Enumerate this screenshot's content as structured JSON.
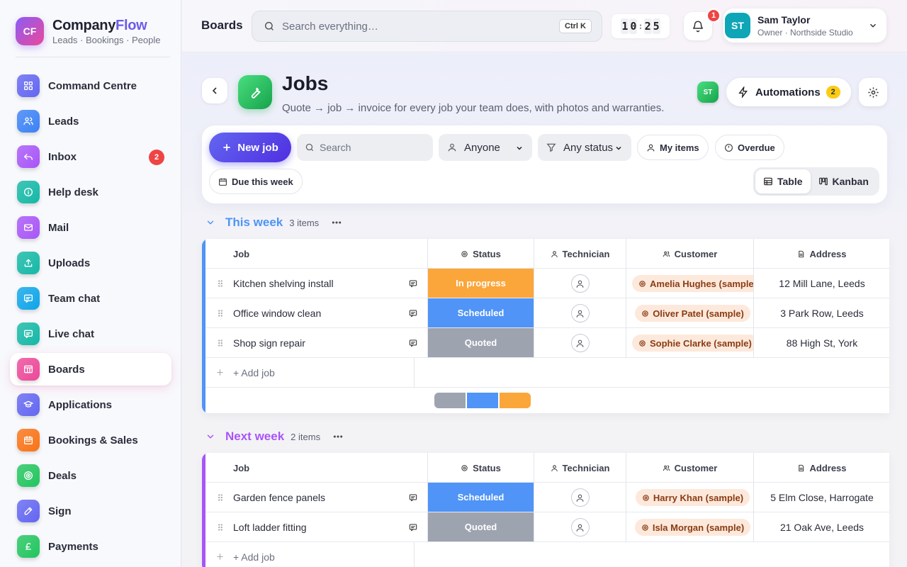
{
  "brand": {
    "initials": "CF",
    "name_a": "Company",
    "name_b": "Flow",
    "subtitle": "Leads · Bookings · People"
  },
  "nav": [
    {
      "label": "Command Centre",
      "icon": "grid-icon",
      "color": "#6366f1"
    },
    {
      "label": "Leads",
      "icon": "users-icon",
      "color": "#3b82f6"
    },
    {
      "label": "Inbox",
      "icon": "reply-icon",
      "color": "#a855f7",
      "badge": "2"
    },
    {
      "label": "Help desk",
      "icon": "info-icon",
      "color": "#14b8a6"
    },
    {
      "label": "Mail",
      "icon": "mail-icon",
      "color": "#a855f7"
    },
    {
      "label": "Uploads",
      "icon": "upload-icon",
      "color": "#14b8a6"
    },
    {
      "label": "Team chat",
      "icon": "chat-icon",
      "color": "#0ea5e9"
    },
    {
      "label": "Live chat",
      "icon": "chat-icon",
      "color": "#14b8a6"
    },
    {
      "label": "Boards",
      "icon": "board-icon",
      "color": "#ec4899",
      "active": true
    },
    {
      "label": "Applications",
      "icon": "graduation-cap-icon",
      "color": "#6366f1"
    },
    {
      "label": "Bookings & Sales",
      "icon": "calendar-icon",
      "color": "#f97316"
    },
    {
      "label": "Deals",
      "icon": "target-icon",
      "color": "#22c55e"
    },
    {
      "label": "Sign",
      "icon": "pen-icon",
      "color": "#6366f1"
    },
    {
      "label": "Payments",
      "icon": "pound-icon",
      "color": "#22c55e"
    }
  ],
  "topbar": {
    "title": "Boards",
    "search_placeholder": "Search everything…",
    "search_shortcut": "Ctrl K",
    "clock": [
      "1",
      "0",
      "2",
      "5"
    ],
    "notifications": "1",
    "user": {
      "initials": "ST",
      "name": "Sam Taylor",
      "role": "Owner · Northside Studio"
    }
  },
  "page": {
    "title": "Jobs",
    "subtitle": "Quote → job → invoice for every job your team does, with photos and warranties.",
    "member_initials": "ST",
    "automations_label": "Automations",
    "automations_count": "2"
  },
  "toolbar": {
    "new_job": "New job",
    "search_placeholder": "Search",
    "person_filter": "Anyone",
    "status_filter": "Any status",
    "chips": [
      "My items",
      "Overdue",
      "Due this week"
    ],
    "views": [
      "Table",
      "Kanban"
    ],
    "active_view": "Table"
  },
  "columns": {
    "job": "Job",
    "status": "Status",
    "technician": "Technician",
    "customer": "Customer",
    "address": "Address"
  },
  "status_colors": {
    "In progress": "#fba63b",
    "Scheduled": "#4f94f6",
    "Quoted": "#9ea3b0"
  },
  "groups": [
    {
      "title": "This week",
      "count": "3 items",
      "color": "#4f94f6",
      "add_label": "+ Add job",
      "rows": [
        {
          "job": "Kitchen shelving install",
          "status": "In progress",
          "customer": "Amelia Hughes (sample)",
          "address": "12 Mill Lane, Leeds"
        },
        {
          "job": "Office window clean",
          "status": "Scheduled",
          "customer": "Oliver Patel (sample)",
          "address": "3 Park Row, Leeds"
        },
        {
          "job": "Shop sign repair",
          "status": "Quoted",
          "customer": "Sophie Clarke (sample)",
          "address": "88 High St, York"
        }
      ],
      "summary": [
        {
          "status": "Quoted",
          "count": 1
        },
        {
          "status": "Scheduled",
          "count": 1
        },
        {
          "status": "In progress",
          "count": 1
        }
      ]
    },
    {
      "title": "Next week",
      "count": "2 items",
      "color": "#a855f7",
      "add_label": "+ Add job",
      "rows": [
        {
          "job": "Garden fence panels",
          "status": "Scheduled",
          "customer": "Harry Khan (sample)",
          "address": "5 Elm Close, Harrogate"
        },
        {
          "job": "Loft ladder fitting",
          "status": "Quoted",
          "customer": "Isla Morgan (sample)",
          "address": "21 Oak Ave, Leeds"
        }
      ]
    }
  ]
}
